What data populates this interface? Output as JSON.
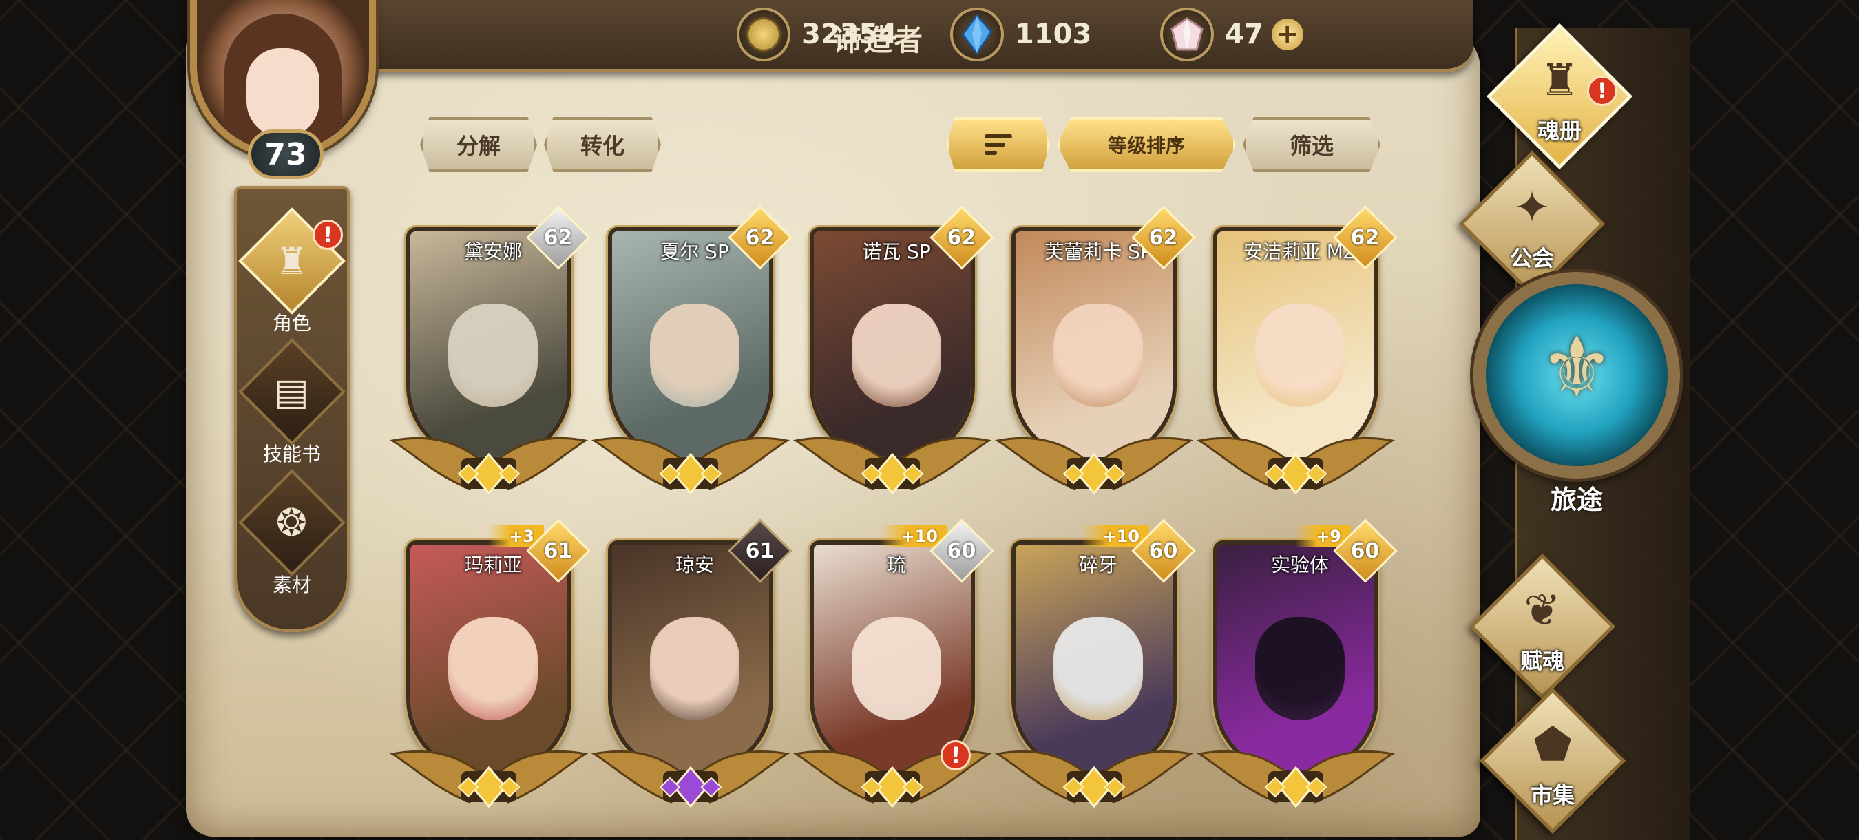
{
  "header": {
    "title": "谛造者",
    "resources": [
      {
        "name": "gold",
        "icon": "gold-coin-icon",
        "value": "32354"
      },
      {
        "name": "crystal",
        "icon": "blue-crystal-icon",
        "value": "1103"
      },
      {
        "name": "gem",
        "icon": "pink-gem-icon",
        "value": "47"
      }
    ],
    "plus_label": "+"
  },
  "player": {
    "level": "73"
  },
  "left_nav": [
    {
      "label": "角色",
      "icon": "character-icon",
      "active": true,
      "alert": "!"
    },
    {
      "label": "技能书",
      "icon": "skill-book-icon",
      "active": false
    },
    {
      "label": "素材",
      "icon": "material-icon",
      "active": false
    }
  ],
  "toolbar": {
    "decompose": "分解",
    "convert": "转化",
    "sort_order_icon": "sort-lines-icon",
    "sort_by": "等级排序",
    "filter": "筛选"
  },
  "cards": [
    {
      "name": "黛安娜",
      "level": "62",
      "badge": "silver",
      "bonus": "",
      "palette": [
        "#c8b79a",
        "#4b4a3e",
        "#d9d2c2"
      ],
      "gem": "gold"
    },
    {
      "name": "夏尔 SP",
      "level": "62",
      "badge": "gold",
      "bonus": "",
      "palette": [
        "#a9b6b0",
        "#5c6964",
        "#e7d2bb"
      ],
      "gem": "gold"
    },
    {
      "name": "诺瓦 SP",
      "level": "62",
      "badge": "gold",
      "bonus": "",
      "palette": [
        "#7c4a34",
        "#3a2a2a",
        "#f1d5c3"
      ],
      "gem": "gold"
    },
    {
      "name": "芙蕾莉卡 SP",
      "level": "62",
      "badge": "gold",
      "bonus": "",
      "palette": [
        "#c2895a",
        "#e6d0b8",
        "#f2d4bf"
      ],
      "gem": "gold"
    },
    {
      "name": "安洁莉亚 MZ",
      "level": "62",
      "badge": "gold",
      "bonus": "",
      "palette": [
        "#e7c37b",
        "#f4e6c6",
        "#f7dcc6"
      ],
      "gem": "gold"
    },
    {
      "name": "玛莉亚",
      "level": "61",
      "badge": "gold",
      "bonus": "+3",
      "palette": [
        "#c65a5a",
        "#6b4a2a",
        "#f6d6c2"
      ],
      "gem": "gold"
    },
    {
      "name": "琼安",
      "level": "61",
      "badge": "dark",
      "bonus": "",
      "palette": [
        "#4a3428",
        "#8a6b4a",
        "#efd2c0"
      ],
      "gem": "purple"
    },
    {
      "name": "琉",
      "level": "60",
      "badge": "silver",
      "bonus": "+10",
      "palette": [
        "#e9ddd0",
        "#7a3a2a",
        "#f5e0d2"
      ],
      "gem": "gold",
      "alert": "!"
    },
    {
      "name": "碎牙",
      "level": "60",
      "badge": "gold",
      "bonus": "+10",
      "palette": [
        "#c9a45a",
        "#4a3a5a",
        "#e8e8e8"
      ],
      "gem": "gold"
    },
    {
      "name": "实验体",
      "level": "60",
      "badge": "gold",
      "bonus": "+9",
      "palette": [
        "#3a2040",
        "#8a2aa0",
        "#1a1020"
      ],
      "gem": "gold"
    }
  ],
  "right_nav": [
    {
      "label": "魂册",
      "icon": "soul-book-icon",
      "active": true,
      "alert": "!"
    },
    {
      "label": "公会",
      "icon": "guild-icon",
      "active": false
    },
    {
      "label": "赋魂",
      "icon": "soul-infuse-icon",
      "active": false
    },
    {
      "label": "市集",
      "icon": "market-icon",
      "active": false
    }
  ],
  "journey": {
    "label": "旅途",
    "icon": "journey-emblem-icon"
  },
  "colors": {
    "accent_gold": "#d1a13d",
    "parchment": "#dccfb0",
    "frame_brown": "#a8864d",
    "alert_red": "#d8361e",
    "journey_teal": "#22a2bf"
  }
}
